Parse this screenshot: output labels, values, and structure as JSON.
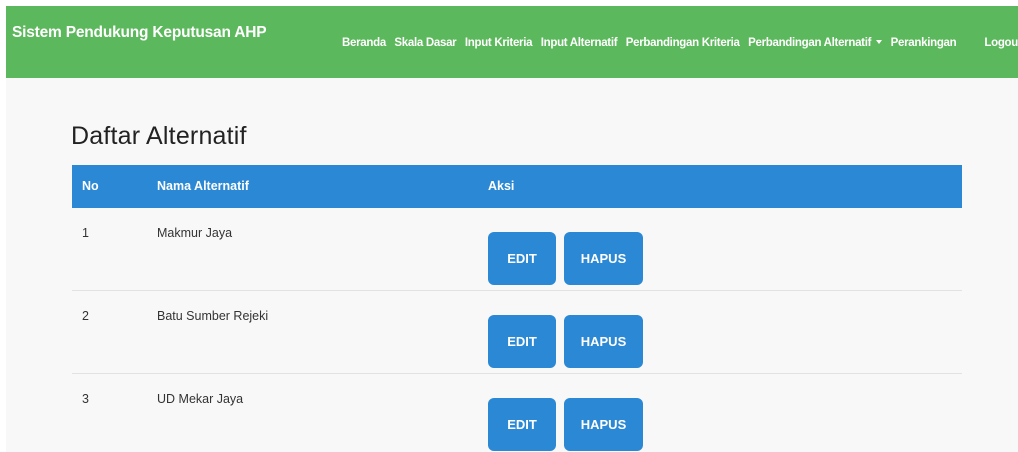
{
  "navbar": {
    "brand": "Sistem Pendukung Keputusan AHP",
    "items": [
      {
        "label": "Beranda"
      },
      {
        "label": "Skala Dasar"
      },
      {
        "label": "Input Kriteria"
      },
      {
        "label": "Input Alternatif"
      },
      {
        "label": "Perbandingan Kriteria"
      },
      {
        "label": "Perbandingan Alternatif",
        "dropdown": true
      },
      {
        "label": "Perankingan"
      },
      {
        "label": "Logout"
      }
    ]
  },
  "main": {
    "title": "Daftar Alternatif",
    "table": {
      "headers": [
        "No",
        "Nama Alternatif",
        "Aksi"
      ],
      "rows": [
        {
          "no": "1",
          "nama": "Makmur Jaya"
        },
        {
          "no": "2",
          "nama": "Batu Sumber Rejeki"
        },
        {
          "no": "3",
          "nama": "UD Mekar Jaya"
        }
      ],
      "edit_label": "EDIT",
      "delete_label": "HAPUS"
    }
  },
  "colors": {
    "navbar_bg": "#5cb85c",
    "primary": "#2a88d4",
    "page_bg": "#f8f8f8"
  }
}
